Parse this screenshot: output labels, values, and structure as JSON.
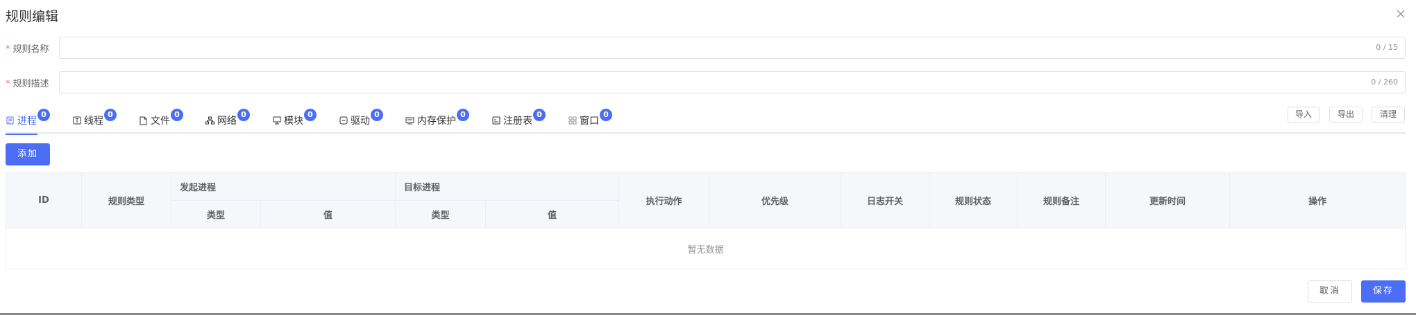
{
  "dialog": {
    "title": "规则编辑",
    "close_icon": "close-icon"
  },
  "form": {
    "name": {
      "label": "规则名称",
      "value": "",
      "counter": "0 / 15"
    },
    "desc": {
      "label": "规则描述",
      "value": "",
      "counter": "0 / 260"
    }
  },
  "tabs": [
    {
      "label": "进程",
      "icon": "process-icon",
      "badge": "0"
    },
    {
      "label": "线程",
      "icon": "thread-icon",
      "badge": "0"
    },
    {
      "label": "文件",
      "icon": "file-icon",
      "badge": "0"
    },
    {
      "label": "网络",
      "icon": "network-icon",
      "badge": "0"
    },
    {
      "label": "模块",
      "icon": "module-icon",
      "badge": "0"
    },
    {
      "label": "驱动",
      "icon": "driver-icon",
      "badge": "0"
    },
    {
      "label": "内存保护",
      "icon": "memory-icon",
      "badge": "0"
    },
    {
      "label": "注册表",
      "icon": "registry-icon",
      "badge": "0"
    },
    {
      "label": "窗口",
      "icon": "window-grid-icon",
      "badge": "0"
    }
  ],
  "toolbar": {
    "import_label": "导入",
    "export_label": "导出",
    "clear_label": "清理",
    "add_label": "添加"
  },
  "table": {
    "col_id": "ID",
    "col_rule_type": "规则类型",
    "group_source": "发起进程",
    "group_target": "目标进程",
    "sub_type": "类型",
    "sub_value": "值",
    "col_action": "执行动作",
    "col_priority": "优先级",
    "col_log": "日志开关",
    "col_status": "规则状态",
    "col_note": "规则备注",
    "col_updated": "更新时间",
    "col_ops": "操作",
    "empty_text": "暂无数据"
  },
  "footer": {
    "cancel_label": "取消",
    "save_label": "保存"
  },
  "colors": {
    "accent": "#4b6ef5",
    "required": "#f56c6c"
  }
}
